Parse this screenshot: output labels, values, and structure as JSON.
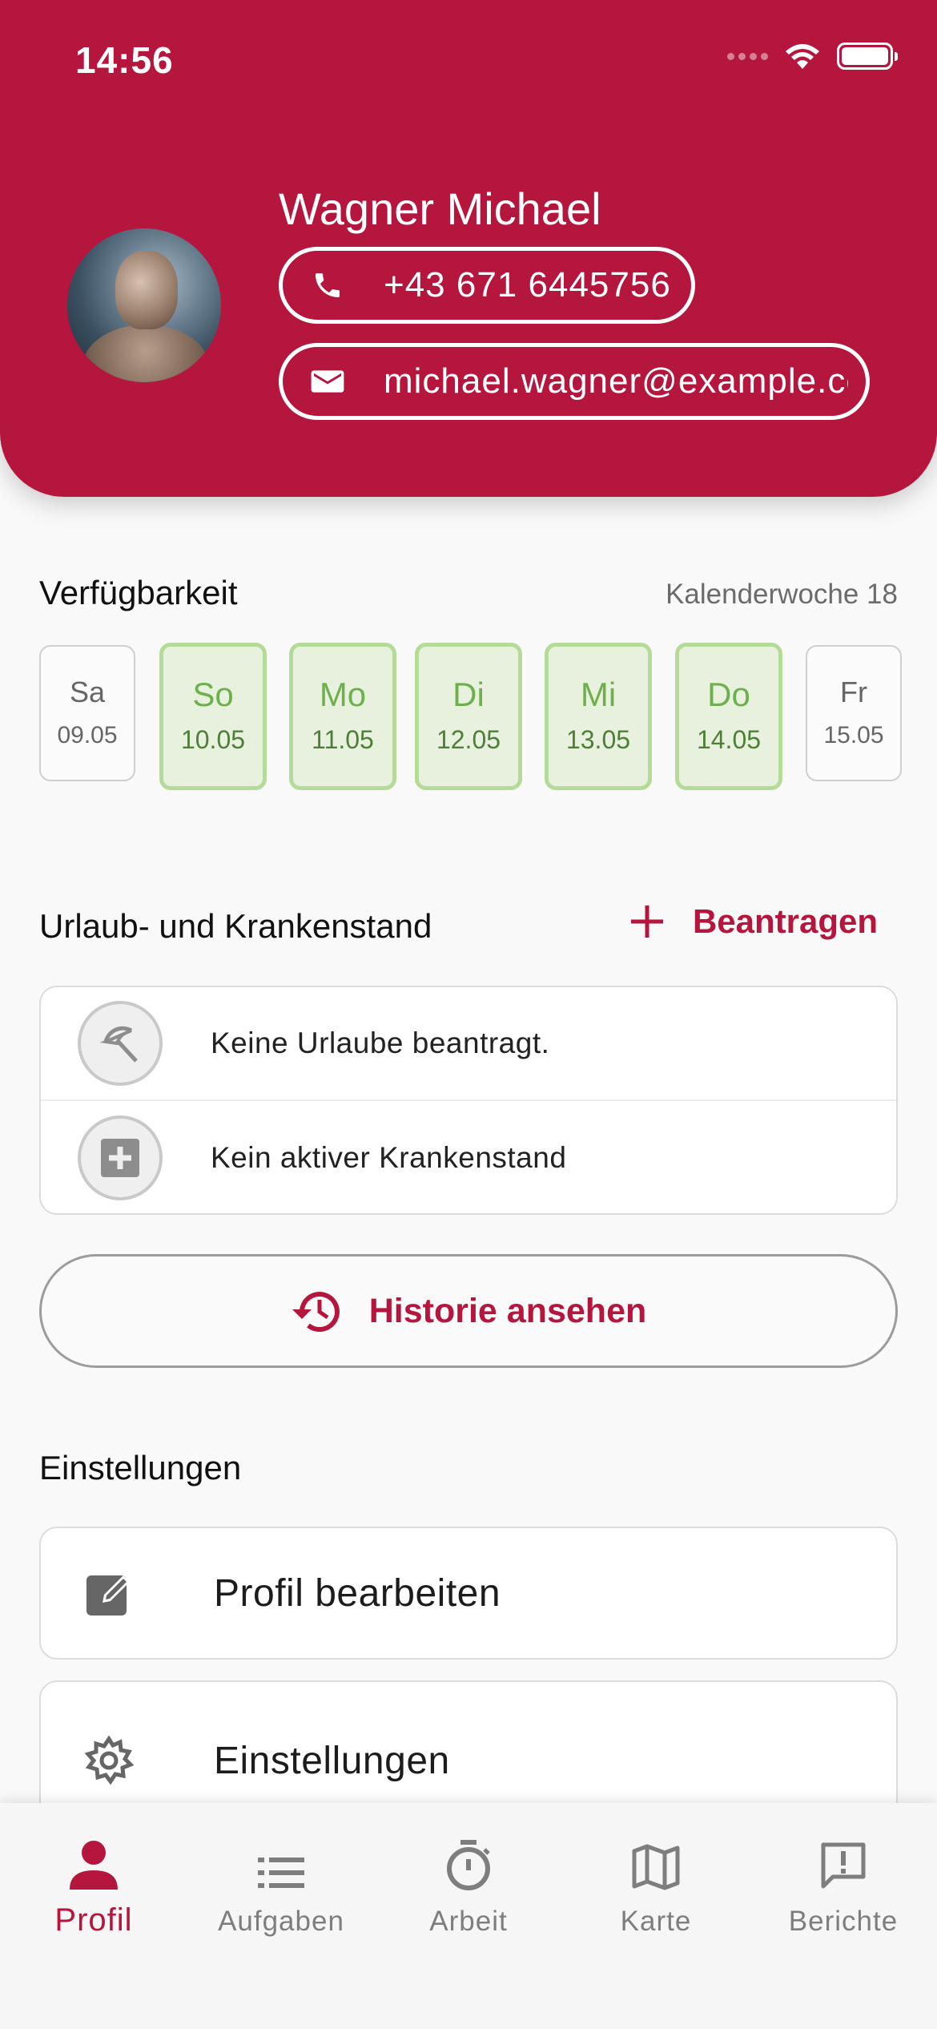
{
  "status_bar": {
    "time": "14:56"
  },
  "profile": {
    "name": "Wagner Michael",
    "phone": "+43 671 6445756",
    "email": "michael.wagner@example.com"
  },
  "availability": {
    "title": "Verfügbarkeit",
    "week_label": "Kalenderwoche 18",
    "days": [
      {
        "name": "Sa",
        "date": "09.05",
        "available": false
      },
      {
        "name": "So",
        "date": "10.05",
        "available": true
      },
      {
        "name": "Mo",
        "date": "11.05",
        "available": true
      },
      {
        "name": "Di",
        "date": "12.05",
        "available": true
      },
      {
        "name": "Mi",
        "date": "13.05",
        "available": true
      },
      {
        "name": "Do",
        "date": "14.05",
        "available": true
      },
      {
        "name": "Fr",
        "date": "15.05",
        "available": false
      }
    ],
    "available_color": "#6fb04e"
  },
  "leave": {
    "title": "Urlaub- und Krankenstand",
    "request_label": "Beantragen",
    "vacation_text": "Keine Urlaube beantragt.",
    "sick_text": "Kein aktiver Krankenstand",
    "history_label": "Historie ansehen"
  },
  "settings": {
    "title": "Einstellungen",
    "items": [
      {
        "label": "Profil bearbeiten",
        "icon": "edit-icon"
      },
      {
        "label": "Einstellungen",
        "icon": "gear-icon"
      }
    ]
  },
  "bottom_nav": {
    "items": [
      {
        "label": "Profil",
        "icon": "person-icon",
        "active": true
      },
      {
        "label": "Aufgaben",
        "icon": "list-icon",
        "active": false
      },
      {
        "label": "Arbeit",
        "icon": "timer-icon",
        "active": false
      },
      {
        "label": "Karte",
        "icon": "map-icon",
        "active": false
      },
      {
        "label": "Berichte",
        "icon": "report-icon",
        "active": false
      }
    ]
  },
  "colors": {
    "brand": "#b5163e",
    "available_bg": "#e8f1dd",
    "available_border": "#b5db98"
  }
}
